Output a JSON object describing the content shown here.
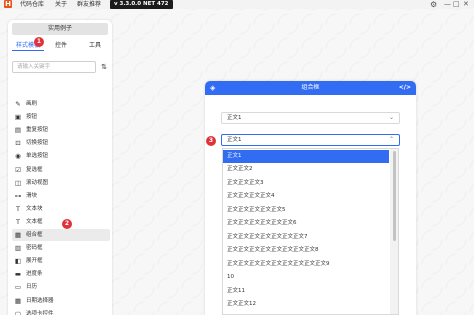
{
  "topbar": {
    "logo": "H",
    "menu": [
      "代码仓库",
      "关于",
      "群友推荐"
    ],
    "version": "v 3.3.0.0 NET 472",
    "window_controls": [
      "—",
      "□",
      "✕"
    ],
    "icons": {
      "settings": "gear-icon",
      "minimize": "minimize-icon",
      "maximize": "maximize-icon",
      "close": "close-icon"
    }
  },
  "sidebar": {
    "title": "实用例子",
    "tabs": [
      "样式模板",
      "控件",
      "工具"
    ],
    "active_tab": 0,
    "search_placeholder": "请输入关键字",
    "items": [
      {
        "icon": "✎",
        "icon_name": "brush-icon",
        "label": "画刷"
      },
      {
        "icon": "▣",
        "icon_name": "button-icon",
        "label": "按钮"
      },
      {
        "icon": "▤",
        "icon_name": "repeat-button-icon",
        "label": "重复按钮"
      },
      {
        "icon": "⊡",
        "icon_name": "toggle-button-icon",
        "label": "切换按钮"
      },
      {
        "icon": "◉",
        "icon_name": "radio-button-icon",
        "label": "单选按钮"
      },
      {
        "icon": "☑",
        "icon_name": "checkbox-icon",
        "label": "复选框"
      },
      {
        "icon": "◫",
        "icon_name": "scrollviewer-icon",
        "label": "滚动视图"
      },
      {
        "icon": "⊶",
        "icon_name": "slider-icon",
        "label": "滑块"
      },
      {
        "icon": "T",
        "icon_name": "textblock-icon",
        "label": "文本块"
      },
      {
        "icon": "T",
        "icon_name": "textbox-icon",
        "label": "文本框"
      },
      {
        "icon": "▦",
        "icon_name": "combobox-icon",
        "label": "组合框"
      },
      {
        "icon": "▥",
        "icon_name": "passwordbox-icon",
        "label": "密码框"
      },
      {
        "icon": "◧",
        "icon_name": "expander-icon",
        "label": "展开框"
      },
      {
        "icon": "▬",
        "icon_name": "progressbar-icon",
        "label": "进度条"
      },
      {
        "icon": "▭",
        "icon_name": "calendar-icon",
        "label": "日历"
      },
      {
        "icon": "▦",
        "icon_name": "datepicker-icon",
        "label": "日期选择器"
      },
      {
        "icon": "▢",
        "icon_name": "tabcontrol-icon",
        "label": "选项卡控件"
      }
    ],
    "selected_item": 10
  },
  "demo": {
    "title": "组合框",
    "combo1_value": "正文1",
    "combo2_value": "正文1",
    "options": [
      "正文1",
      "正文正文2",
      "正文正文正文3",
      "正文正文正文正文4",
      "正文正文正文正文正文5",
      "正文正文正文正文正文正文6",
      "正文正文正文正文正文正文正文7",
      "正文正文正文正文正文正文正文正文8",
      "正文正文正文正文正文正文正文正文正文9",
      "10",
      "正文11",
      "正文正文12"
    ],
    "selected_option": 0
  },
  "badges": [
    "1",
    "2",
    "3"
  ],
  "colors": {
    "accent": "#326cf3",
    "badge": "#e0323a",
    "logo": "#e8541c"
  }
}
